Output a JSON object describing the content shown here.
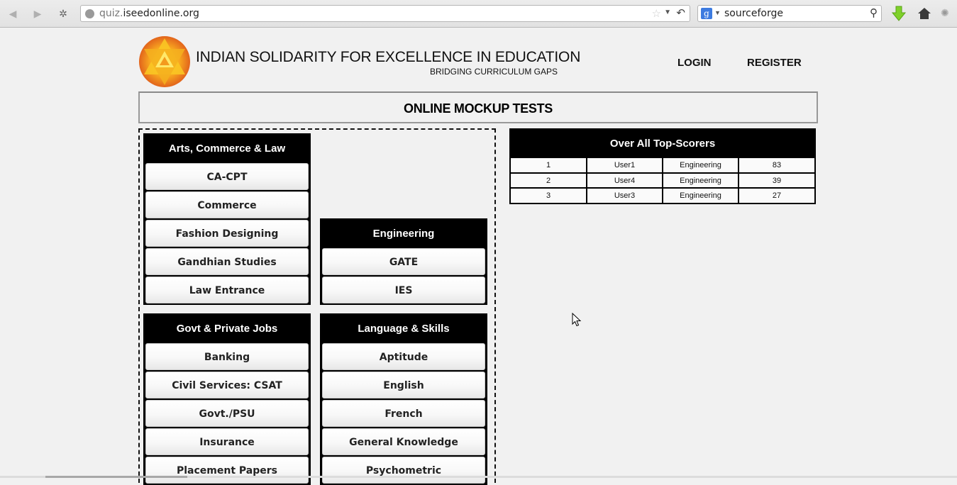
{
  "browser": {
    "url_prefix": "quiz.",
    "url_domain": "iseedonline.org",
    "search_engine_icon": "g",
    "search_query": "sourceforge",
    "icons": {
      "back": "◀",
      "forward": "▶",
      "history": "✲",
      "star": "☆",
      "dropdown": "▼",
      "reload": "↶",
      "search": "⚲",
      "addon": "✺"
    }
  },
  "header": {
    "title": "INDIAN SOLIDARITY FOR EXCELLENCE IN EDUCATION",
    "tagline": "BRIDGING CURRICULUM GAPS",
    "login_label": "LOGIN",
    "register_label": "REGISTER"
  },
  "banner": {
    "title": "ONLINE MOCKUP TESTS"
  },
  "categories": [
    {
      "title": "Arts, Commerce & Law",
      "items": [
        "CA-CPT",
        "Commerce",
        "Fashion Designing",
        "Gandhian Studies",
        "Law Entrance"
      ]
    },
    {
      "title": "Engineering",
      "items": [
        "GATE",
        "IES"
      ]
    },
    {
      "title": "Govt & Private Jobs",
      "items": [
        "Banking",
        "Civil Services: CSAT",
        "Govt./PSU",
        "Insurance",
        "Placement Papers"
      ]
    },
    {
      "title": "Language & Skills",
      "items": [
        "Aptitude",
        "English",
        "French",
        "General Knowledge",
        "Psychometric"
      ]
    }
  ],
  "top_scorers": {
    "title": "Over All Top-Scorers",
    "rows": [
      [
        "1",
        "User1",
        "Engineering",
        "83"
      ],
      [
        "2",
        "User4",
        "Engineering",
        "39"
      ],
      [
        "3",
        "User3",
        "Engineering",
        "27"
      ]
    ]
  }
}
